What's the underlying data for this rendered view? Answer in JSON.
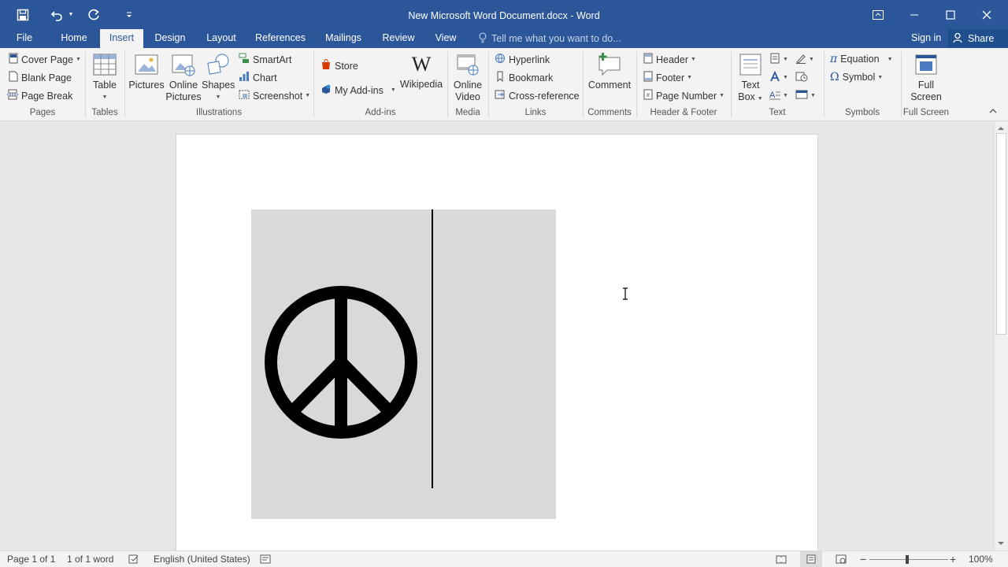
{
  "window": {
    "title": "New Microsoft Word Document.docx - Word"
  },
  "qat": {
    "save_icon": "save-icon",
    "undo_icon": "undo-icon",
    "redo_icon": "redo-icon",
    "customize_icon": "customize-qat-icon"
  },
  "tabs": [
    "File",
    "Home",
    "Insert",
    "Design",
    "Layout",
    "References",
    "Mailings",
    "Review",
    "View"
  ],
  "active_tab": "Insert",
  "tell_me": "Tell me what you want to do...",
  "sign_in": "Sign in",
  "share": "Share",
  "ribbon": {
    "cover_page": "Cover Page",
    "blank_page": "Blank Page",
    "page_break": "Page Break",
    "table": "Table",
    "pictures": "Pictures",
    "online": "Online",
    "pictures2": "Pictures",
    "shapes": "Shapes",
    "smartart": "SmartArt",
    "chart": "Chart",
    "screenshot": "Screenshot",
    "store": "Store",
    "my_addins": "My Add-ins",
    "wikipedia": "Wikipedia",
    "online_video_1": "Online",
    "online_video_2": "Video",
    "hyperlink": "Hyperlink",
    "bookmark": "Bookmark",
    "cross_reference": "Cross-reference",
    "comment": "Comment",
    "header": "Header",
    "footer": "Footer",
    "page_number": "Page Number",
    "text_1": "Text",
    "text_2": "Box",
    "equation": "Equation",
    "symbol": "Symbol",
    "full_1": "Full",
    "full_2": "Screen",
    "wiki_glyph": "W",
    "omega_glyph": "Ω",
    "pi_glyph": "π"
  },
  "groups": [
    "Pages",
    "Tables",
    "Illustrations",
    "Add-ins",
    "Media",
    "Links",
    "Comments",
    "Header & Footer",
    "Text",
    "Symbols",
    "Full Screen"
  ],
  "document": {
    "image": "peace-sign-image"
  },
  "status": {
    "page": "Page 1 of 1",
    "words": "1 of 1 word",
    "language": "English (United States)",
    "zoom": "100%"
  },
  "colors": {
    "brand": "#2b579a",
    "ribbon": "#f3f3f3",
    "canvas": "#e6e6e6"
  }
}
